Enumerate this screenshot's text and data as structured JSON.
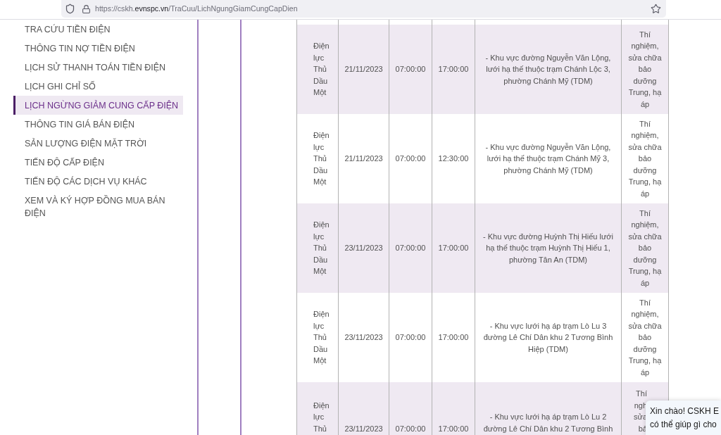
{
  "browser": {
    "url": {
      "prefix": "https://cskh.",
      "domain": "evnspc.vn",
      "path": "/TraCuu/LichNgungGiamCungCapDien"
    }
  },
  "sidebar": {
    "items": [
      {
        "label": "TRA CỨU TIỀN ĐIỆN",
        "selected": false
      },
      {
        "label": "THÔNG TIN NỢ TIỀN ĐIỆN",
        "selected": false
      },
      {
        "label": "LỊCH SỬ THANH TOÁN TIỀN ĐIỆN",
        "selected": false
      },
      {
        "label": "LỊCH GHI CHỈ SỐ",
        "selected": false
      },
      {
        "label": "LỊCH NGỪNG GIẢM CUNG CẤP ĐIỆN",
        "selected": true
      },
      {
        "label": "THÔNG TIN GIÁ BÁN ĐIỆN",
        "selected": false
      },
      {
        "label": "SẢN LƯỢNG ĐIỆN MẶT TRỜI",
        "selected": false
      },
      {
        "label": "TIẾN ĐỘ CẤP ĐIỆN",
        "selected": false
      },
      {
        "label": "TIẾN ĐỘ CÁC DỊCH VỤ KHÁC",
        "selected": false
      },
      {
        "label": "XEM VÀ KÝ HỢP ĐỒNG MUA BÁN ĐIỆN",
        "selected": false
      }
    ]
  },
  "table": {
    "rows": [
      {
        "cells": [
          "Điện lực Thủ Dầu Một",
          "21/11/2023",
          "07:00:00",
          "17:00:00",
          "- Khu vực đường Nguyễn Văn Lộng, lưới hạ thế thuộc trạm Chánh Lộc 3, phường Chánh Mỹ (TDM)",
          "Thí nghiệm, sửa chữa bảo dưỡng Trung, hạ áp"
        ]
      },
      {
        "cells": [
          "Điện lực Thủ Dầu Một",
          "21/11/2023",
          "07:00:00",
          "12:30:00",
          "- Khu vực đường Nguyễn Văn Lộng, lưới hạ thế thuộc trạm Chánh Mỹ 3, phường Chánh Mỹ (TDM)",
          "Thí nghiệm, sửa chữa bảo dưỡng Trung, hạ áp"
        ]
      },
      {
        "cells": [
          "Điện lực Thủ Dầu Một",
          "23/11/2023",
          "07:00:00",
          "17:00:00",
          "- Khu vực đường Huỳnh Thị Hiếu lưới hạ thế thuộc trạm Huỳnh Thị Hiếu 1, phường Tân An (TDM)",
          "Thí nghiệm, sửa chữa bảo dưỡng Trung, hạ áp"
        ]
      },
      {
        "cells": [
          "Điện lực Thủ Dầu Một",
          "23/11/2023",
          "07:00:00",
          "17:00:00",
          "- Khu vực lưới hạ áp trạm Lò Lu 3 đường Lê Chí Dân khu 2 Tương Bình Hiệp (TDM)",
          "Thí nghiệm, sửa chữa bảo dưỡng Trung, hạ áp"
        ]
      },
      {
        "cells": [
          "Điện lực Thủ",
          "23/11/2023",
          "07:00:00",
          "17:00:00",
          "- Khu vực lưới hạ áp trạm Lò Lu 2 đường Lê Chí Dân khu 2 Tương Bình",
          "Thí ngh sửa bả"
        ]
      }
    ]
  },
  "chat_popup": {
    "lines": [
      "Xin chào! CSKH E",
      "có thể giúp gì cho"
    ]
  }
}
